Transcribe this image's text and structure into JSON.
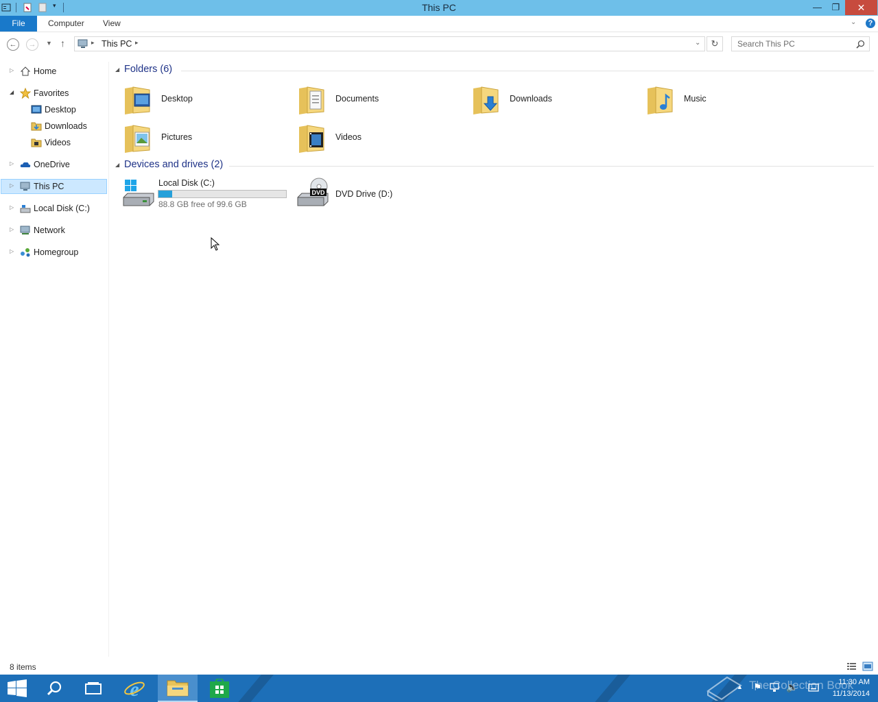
{
  "window": {
    "title": "This PC",
    "minimize_glyph": "—",
    "restore_glyph": "❐",
    "close_glyph": "✕"
  },
  "ribbon": {
    "tabs": [
      "File",
      "Computer",
      "View"
    ],
    "help_glyph": "?"
  },
  "address": {
    "path": [
      "This PC"
    ],
    "search_placeholder": "Search This PC"
  },
  "nav": {
    "items": [
      {
        "label": "Home",
        "icon": "home-icon",
        "expander": "▷"
      },
      {
        "label": "Favorites",
        "icon": "star-icon",
        "expander": "◢"
      },
      {
        "label": "Desktop",
        "icon": "desktop-icon"
      },
      {
        "label": "Downloads",
        "icon": "downloads-icon"
      },
      {
        "label": "Videos",
        "icon": "videos-icon"
      },
      {
        "label": "OneDrive",
        "icon": "cloud-icon",
        "expander": "▷"
      },
      {
        "label": "This PC",
        "icon": "computer-icon",
        "expander": "▷",
        "selected": true
      },
      {
        "label": "Local Disk (C:)",
        "icon": "drive-icon",
        "expander": "▷"
      },
      {
        "label": "Network",
        "icon": "network-icon",
        "expander": "▷"
      },
      {
        "label": "Homegroup",
        "icon": "homegroup-icon",
        "expander": "▷"
      }
    ]
  },
  "content": {
    "folders_header": "Folders (6)",
    "folders": [
      {
        "label": "Desktop",
        "icon": "desktop-folder-icon"
      },
      {
        "label": "Documents",
        "icon": "documents-folder-icon"
      },
      {
        "label": "Downloads",
        "icon": "downloads-folder-icon"
      },
      {
        "label": "Music",
        "icon": "music-folder-icon"
      },
      {
        "label": "Pictures",
        "icon": "pictures-folder-icon"
      },
      {
        "label": "Videos",
        "icon": "videos-folder-icon"
      }
    ],
    "devices_header": "Devices and drives (2)",
    "drives": [
      {
        "label": "Local Disk (C:)",
        "free_text": "88.8 GB free of 99.6 GB",
        "used_fraction": 0.108,
        "icon": "hard-drive-icon"
      },
      {
        "label": "DVD Drive (D:)",
        "icon": "dvd-drive-icon",
        "badge": "DVD"
      }
    ]
  },
  "status": {
    "item_count": "8 items"
  },
  "taskbar": {
    "pinned": [
      "start-icon",
      "search-icon",
      "task-view-icon",
      "internet-explorer-icon",
      "file-explorer-icon",
      "store-icon"
    ],
    "watermark": "The Collection Book",
    "clock_time": "11:30 AM",
    "clock_date": "11/13/2014"
  },
  "colors": {
    "titlebar": "#6ebfe9",
    "file_tab": "#1979ca",
    "taskbar": "#1d6fb8",
    "selection": "#cce8ff",
    "drive_bar_fill": "#26a0da"
  }
}
